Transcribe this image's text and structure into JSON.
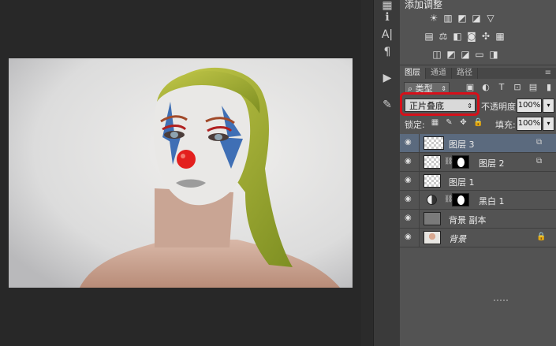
{
  "adjustments": {
    "title": "添加调整",
    "row1_icons": [
      "brightness-icon",
      "levels-icon",
      "curves-icon",
      "exposure-icon",
      "vibrance-icon"
    ],
    "row2_icons": [
      "hue-saturation-icon",
      "color-balance-icon",
      "black-white-icon",
      "photo-filter-icon",
      "channel-mixer-icon",
      "color-lookup-icon"
    ],
    "row3_icons": [
      "invert-icon",
      "posterize-icon",
      "threshold-icon",
      "gradient-map-icon",
      "selective-color-icon"
    ]
  },
  "tabs": [
    {
      "label": "图层",
      "active": true
    },
    {
      "label": "通道",
      "active": false
    },
    {
      "label": "路径",
      "active": false
    }
  ],
  "filter": {
    "kind_label": "类型"
  },
  "blend": {
    "mode": "正片叠底",
    "opacity_label": "不透明度:",
    "opacity_value": "100%",
    "lock_label": "锁定:",
    "fill_label": "填充:",
    "fill_value": "100%"
  },
  "layers": [
    {
      "name": "图层 3",
      "selected": true
    },
    {
      "name": "图层 2",
      "selected": false
    },
    {
      "name": "图层 1",
      "selected": false
    },
    {
      "name": "黑白 1",
      "selected": false
    },
    {
      "name": "背景 副本",
      "selected": false
    },
    {
      "name": "背景",
      "selected": false
    }
  ],
  "colors": {
    "highlight_box": "#d6101a",
    "selected_layer": "#5b6a7e",
    "panel_bg": "#535353"
  }
}
